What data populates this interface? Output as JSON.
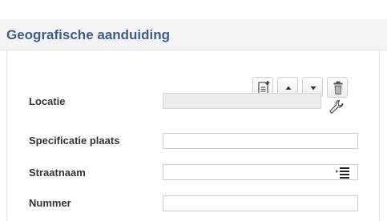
{
  "panel": {
    "title": "Geografische aanduiding"
  },
  "toolbar": {
    "buttons": [
      {
        "name": "add-record-button",
        "icon": "document-add-icon"
      },
      {
        "name": "move-up-button",
        "icon": "triangle-up-icon"
      },
      {
        "name": "move-down-button",
        "icon": "triangle-down-icon"
      },
      {
        "name": "delete-button",
        "icon": "trash-icon"
      }
    ]
  },
  "form": {
    "locatie": {
      "label": "Locatie",
      "value": "",
      "action_icon": "wrench-icon"
    },
    "specificatie_plaats": {
      "label": "Specificatie plaats",
      "value": ""
    },
    "straatnaam": {
      "label": "Straatnaam",
      "value": "",
      "action_icon": "list-select-icon"
    },
    "nummer": {
      "label": "Nummer",
      "value": ""
    }
  },
  "colors": {
    "title": "#3b5f8a",
    "header_bg": "#f4f4f4",
    "label": "#333333",
    "readonly_bg": "#ebebeb",
    "border": "#cdcdcd"
  }
}
